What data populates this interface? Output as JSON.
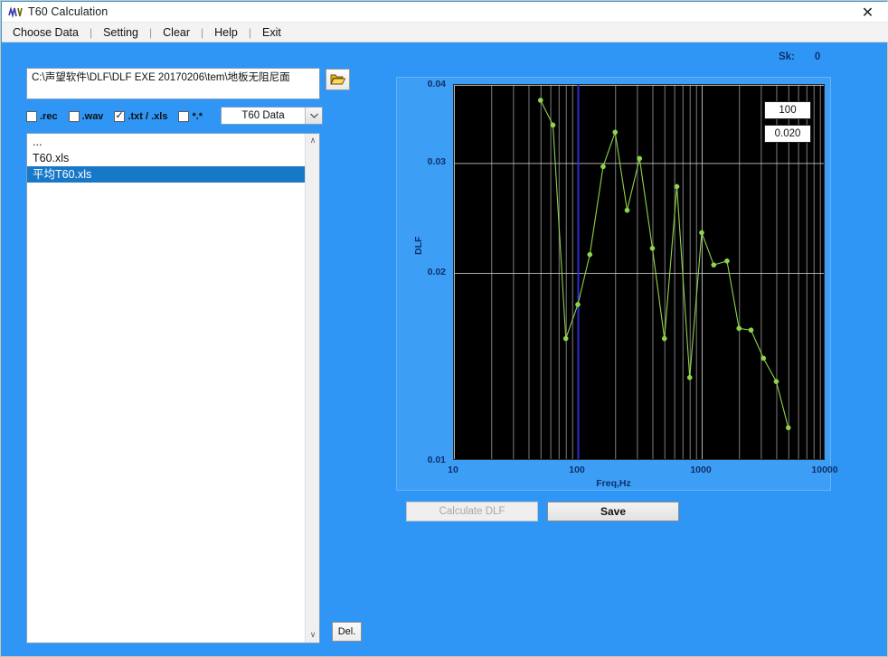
{
  "window": {
    "title": "T60 Calculation",
    "icon": "app-logo-icon",
    "close_label": "✕"
  },
  "menubar": {
    "items": [
      {
        "label": "Choose Data"
      },
      {
        "label": "Setting"
      },
      {
        "label": "Clear"
      },
      {
        "label": "Help"
      },
      {
        "label": "Exit"
      }
    ],
    "separator": "|"
  },
  "left_panel": {
    "path_value": "C:\\声望软件\\DLF\\DLF EXE 20170206\\tem\\地板无阻尼面",
    "browse_icon": "folder-open-icon",
    "filters": [
      {
        "label": ".rec",
        "checked": false
      },
      {
        "label": ".wav",
        "checked": false
      },
      {
        "label": ".txt / .xls",
        "checked": true
      },
      {
        "label": "*.*",
        "checked": false
      }
    ],
    "data_type_select": {
      "value": "T60 Data",
      "arrow": "▼",
      "options": [
        "T60 Data"
      ]
    },
    "file_list": [
      {
        "name": "...",
        "selected": false
      },
      {
        "name": "T60.xls",
        "selected": false
      },
      {
        "name": "平均T60.xls",
        "selected": true
      }
    ],
    "scroll_up": "∧",
    "scroll_down": "∨",
    "delete_button": "Del."
  },
  "right_panel": {
    "sk_label": "Sk:",
    "sk_value": "0",
    "readout_top": "100",
    "readout_bottom": "0.020",
    "calculate_button": "Calculate DLF",
    "calculate_disabled": true,
    "save_button": "Save"
  },
  "colors": {
    "window_bg": "#2f96f5",
    "plot_bg": "#000000",
    "series": "#8fd44a",
    "cursor_line": "#2b2bd8",
    "grid": "#d0d0d0",
    "axis_text": "#0f2f6b",
    "selection": "#1878c8"
  },
  "chart_data": {
    "type": "line",
    "title": "",
    "xlabel": "Freq,Hz",
    "ylabel": "DLF",
    "xscale": "log",
    "yscale": "log",
    "xlim": [
      10,
      10000
    ],
    "ylim": [
      0.01,
      0.04
    ],
    "xticks": [
      10,
      100,
      1000,
      10000
    ],
    "xticklabels": [
      "10",
      "100",
      "1000",
      "10000"
    ],
    "yticks": [
      0.01,
      0.02,
      0.03,
      0.04
    ],
    "yticklabels": [
      "0.01",
      "0.02",
      "0.03",
      "0.04"
    ],
    "grid": true,
    "legend": "none",
    "markers": true,
    "marker_color": "#8fd44a",
    "line_color": "#8fd44a",
    "cursor_x": 100,
    "series": [
      {
        "name": "DLF",
        "x": [
          50,
          63,
          80,
          100,
          125,
          160,
          200,
          250,
          315,
          400,
          500,
          630,
          800,
          1000,
          1250,
          1600,
          2000,
          2500,
          3150,
          4000,
          5000
        ],
        "y": [
          0.0378,
          0.0345,
          0.0157,
          0.0178,
          0.0214,
          0.0296,
          0.0336,
          0.0252,
          0.0305,
          0.0219,
          0.0157,
          0.0275,
          0.0136,
          0.0232,
          0.0206,
          0.0209,
          0.0163,
          0.0162,
          0.0146,
          0.0134,
          0.0113
        ]
      }
    ]
  }
}
